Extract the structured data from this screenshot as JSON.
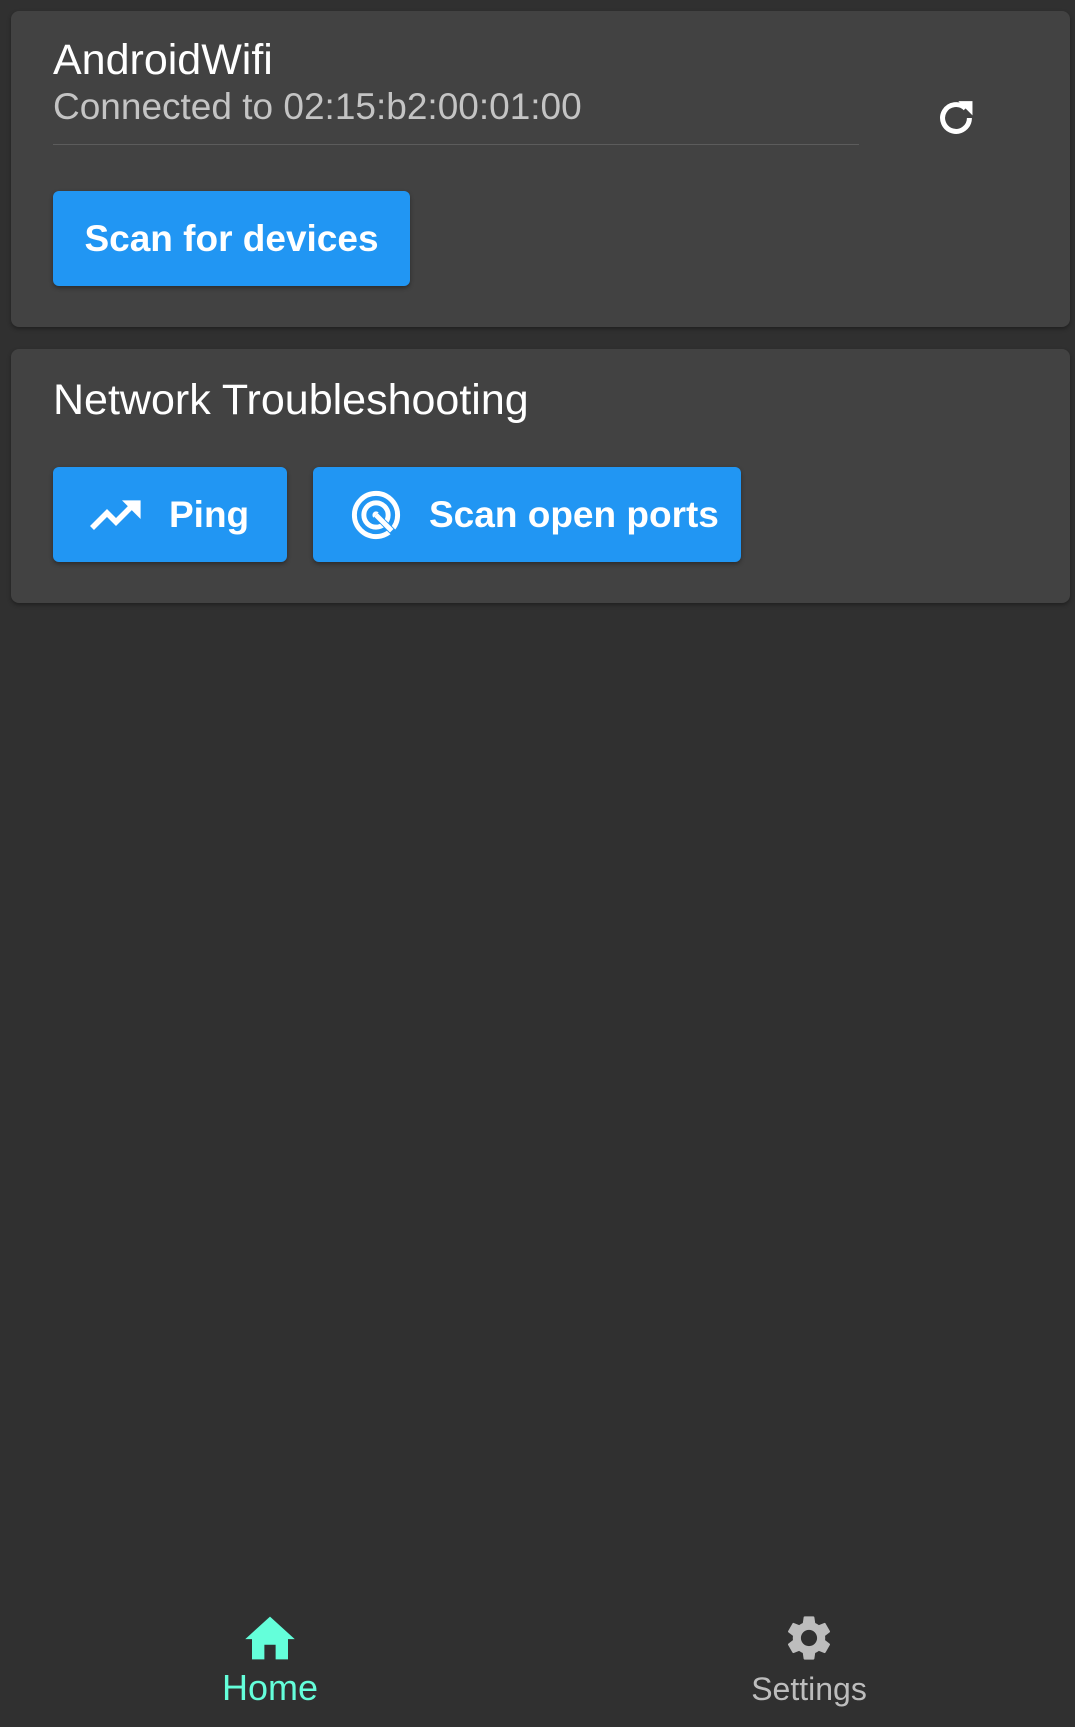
{
  "wifi_card": {
    "network_name": "AndroidWifi",
    "connection_status": "Connected to 02:15:b2:00:01:00",
    "refresh_icon": "refresh-icon",
    "scan_button_label": "Scan for devices"
  },
  "troubleshooting_card": {
    "title": "Network Troubleshooting",
    "ping_label": "Ping",
    "ping_icon": "trending-up-icon",
    "scan_ports_label": "Scan open ports",
    "scan_ports_icon": "target-icon"
  },
  "bottom_nav": {
    "items": [
      {
        "label": "Home",
        "icon": "home-icon",
        "active": true
      },
      {
        "label": "Settings",
        "icon": "gear-icon",
        "active": false
      }
    ]
  },
  "colors": {
    "background": "#303030",
    "card": "#424242",
    "accent_button": "#2196f3",
    "active_nav": "#64ffda",
    "inactive_nav": "#bdbdbd"
  }
}
